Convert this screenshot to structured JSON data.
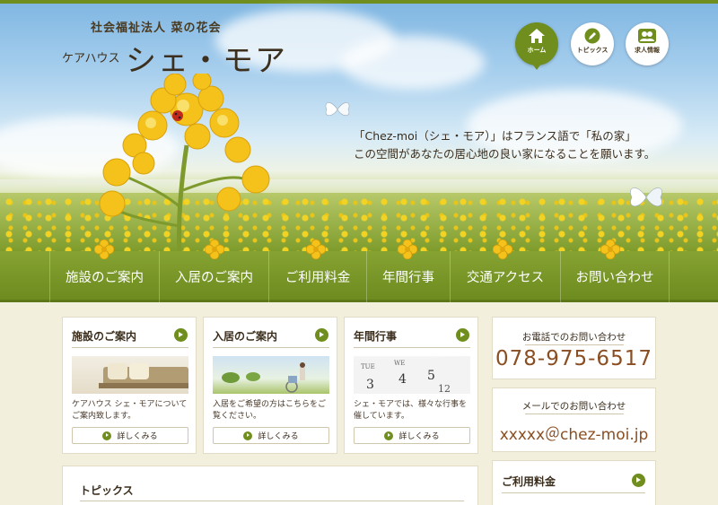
{
  "header": {
    "org_name": "社会福祉法人 菜の花会",
    "site_sub": "ケアハウス",
    "site_main": "シェ・モア",
    "catch_line1": "「Chez-moi（シェ・モア）」はフランス語で「私の家」",
    "catch_line2": "この空間があなたの居心地の良い家になることを願います。"
  },
  "top_nav": [
    {
      "label": "ホーム",
      "icon": "home-icon",
      "active": true
    },
    {
      "label": "トピックス",
      "icon": "pencil-icon",
      "active": false
    },
    {
      "label": "求人情報",
      "icon": "people-icon",
      "active": false
    }
  ],
  "main_nav": [
    "施設のご案内",
    "入居のご案内",
    "ご利用料金",
    "年間行事",
    "交通アクセス",
    "お問い合わせ"
  ],
  "cards": [
    {
      "title": "施設のご案内",
      "text": "ケアハウス シェ・モアについてご案内致します。",
      "button": "詳しくみる"
    },
    {
      "title": "入居のご案内",
      "text": "入居をご希望の方はこちらをご覧ください。",
      "button": "詳しくみる"
    },
    {
      "title": "年間行事",
      "text": "シェ・モアでは、様々な行事を催しています。",
      "button": "詳しくみる"
    }
  ],
  "contact": {
    "phone_label": "お電話でのお問い合わせ",
    "phone": "078-975-6517",
    "mail_label": "メールでのお問い合わせ",
    "mail": "xxxxx＠chez-moi.jp"
  },
  "topics": {
    "title": "トピックス"
  },
  "fee": {
    "title": "ご利用料金"
  },
  "colors": {
    "accent": "#6f8e1d",
    "text": "#3a2d1c",
    "phone": "#8a4e22",
    "background": "#f3efdd"
  }
}
